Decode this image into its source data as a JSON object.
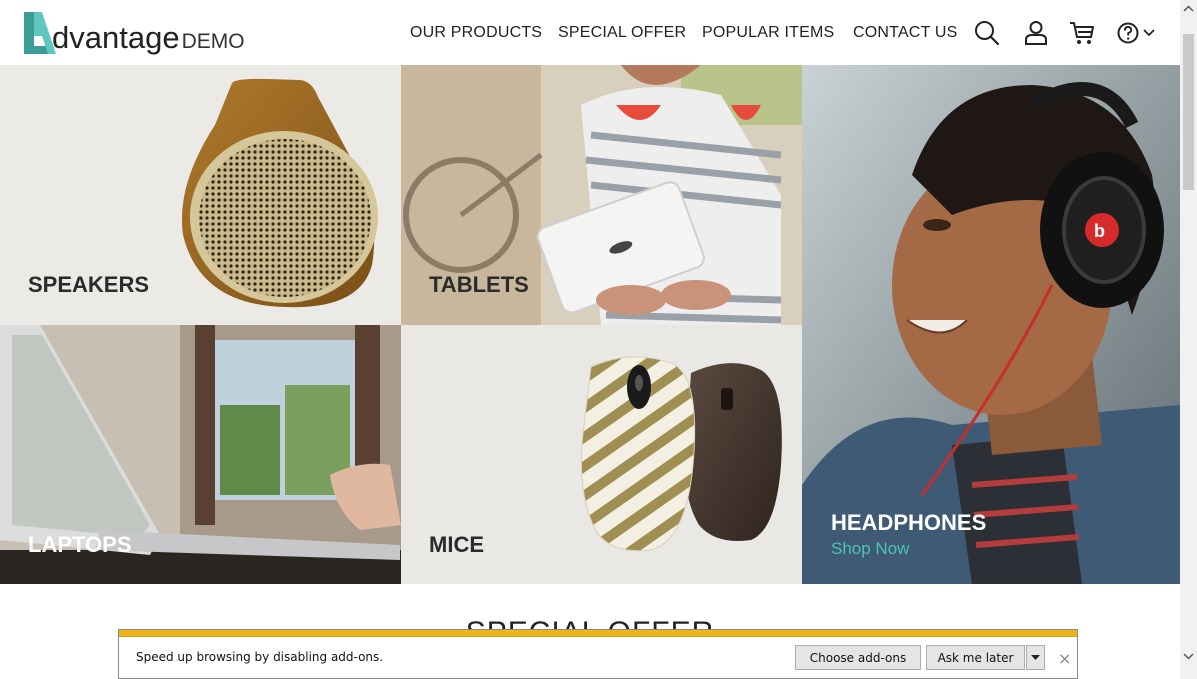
{
  "header": {
    "logo_word": "dvantage",
    "logo_demo": "DEMO",
    "nav": [
      "OUR PRODUCTS",
      "SPECIAL OFFER",
      "POPULAR ITEMS",
      "CONTACT US"
    ],
    "icons": [
      "search-icon",
      "user-icon",
      "cart-icon",
      "help-icon",
      "chevron-down-icon"
    ]
  },
  "tiles": {
    "speakers": "SPEAKERS",
    "tablets": "TABLETS",
    "laptops": "LAPTOPS",
    "mice": "MICE",
    "headphones": "HEADPHONES",
    "headphones_link": "Shop Now"
  },
  "section": {
    "title": "SPECIAL OFFER"
  },
  "notification": {
    "text": "Speed up browsing by disabling add-ons.",
    "choose": "Choose add-ons",
    "later": "Ask me later",
    "close": "×"
  },
  "colors": {
    "accent": "#4ec3b6",
    "notification_stripe": "#f0b31a"
  }
}
